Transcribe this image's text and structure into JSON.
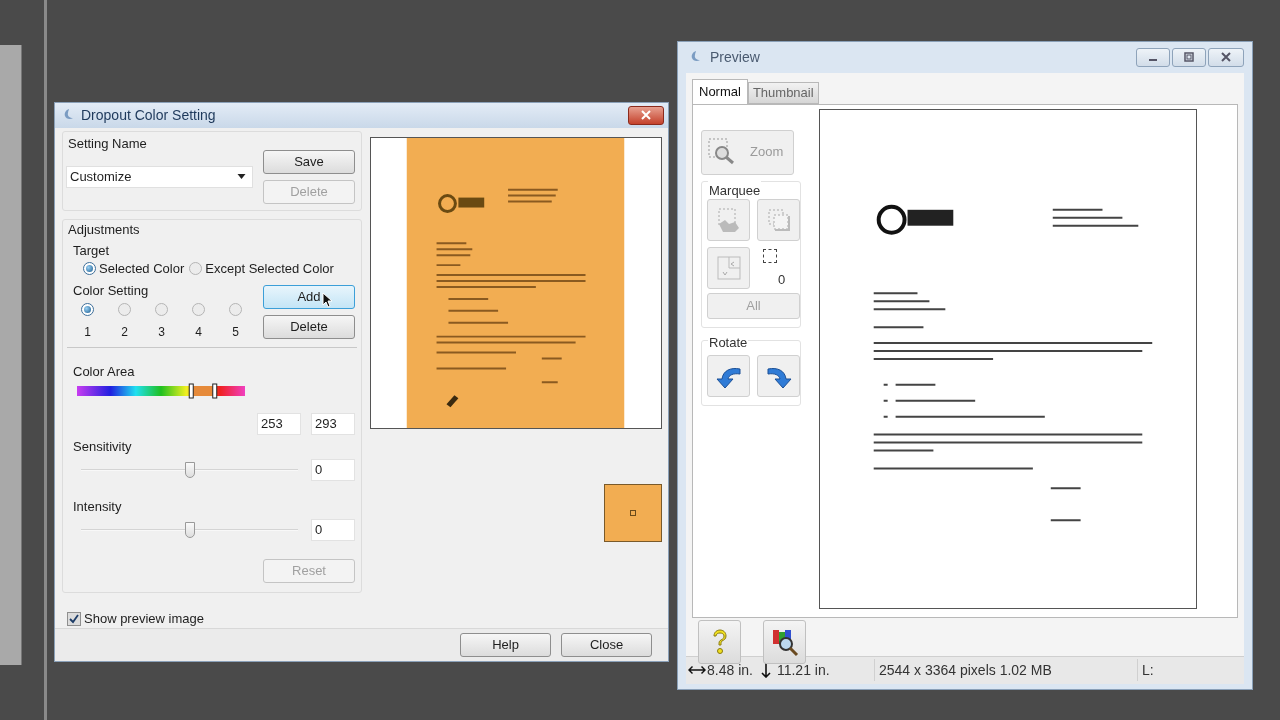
{
  "dropout_dialog": {
    "title": "Dropout Color Setting",
    "setting_name": {
      "label": "Setting Name",
      "value": "Customize",
      "buttons": [
        {
          "label": "Save",
          "disabled": false
        },
        {
          "label": "Delete",
          "disabled": true
        }
      ]
    },
    "adjustments": {
      "label": "Adjustments",
      "target": {
        "label": "Target",
        "options": [
          {
            "label": "Selected Color",
            "selected": true
          },
          {
            "label": "Except Selected Color",
            "selected": false
          }
        ]
      },
      "color_setting": {
        "label": "Color Setting",
        "slots": [
          {
            "label": "1",
            "selected": true
          },
          {
            "label": "2",
            "selected": false
          },
          {
            "label": "3",
            "selected": false
          },
          {
            "label": "4",
            "selected": false
          },
          {
            "label": "5",
            "selected": false
          }
        ],
        "buttons": [
          {
            "label": "Add",
            "disabled": false,
            "focused": true
          },
          {
            "label": "Delete",
            "disabled": false,
            "focused": false
          }
        ]
      },
      "color_area": {
        "label": "Color Area",
        "range_start": {
          "level": 0.68
        },
        "range_end": {
          "level": 0.82
        },
        "from": "253",
        "to": "293"
      },
      "sliders": [
        {
          "label": "Sensitivity",
          "level": 0.5,
          "value": "0"
        },
        {
          "label": "Intensity",
          "level": 0.5,
          "value": "0"
        }
      ],
      "reset": {
        "label": "Reset",
        "disabled": true
      }
    },
    "show_preview": {
      "label": "Show preview image",
      "checked": true
    },
    "buttons": [
      "Help",
      "Close"
    ]
  },
  "preview_window": {
    "title": "Preview",
    "tabs": [
      {
        "label": "Normal",
        "selected": true
      },
      {
        "label": "Thumbnail",
        "selected": false
      }
    ],
    "zoom": {
      "label": "Zoom",
      "disabled": true
    },
    "marquee": {
      "label": "Marquee",
      "count": "0",
      "all": {
        "label": "All",
        "disabled": true
      }
    },
    "rotate": {
      "label": "Rotate"
    },
    "status_bar": {
      "width": "8.48 in.",
      "height": "11.21 in.",
      "size": "2544 x 3364 pixels 1.02 MB",
      "level": "L:"
    }
  }
}
